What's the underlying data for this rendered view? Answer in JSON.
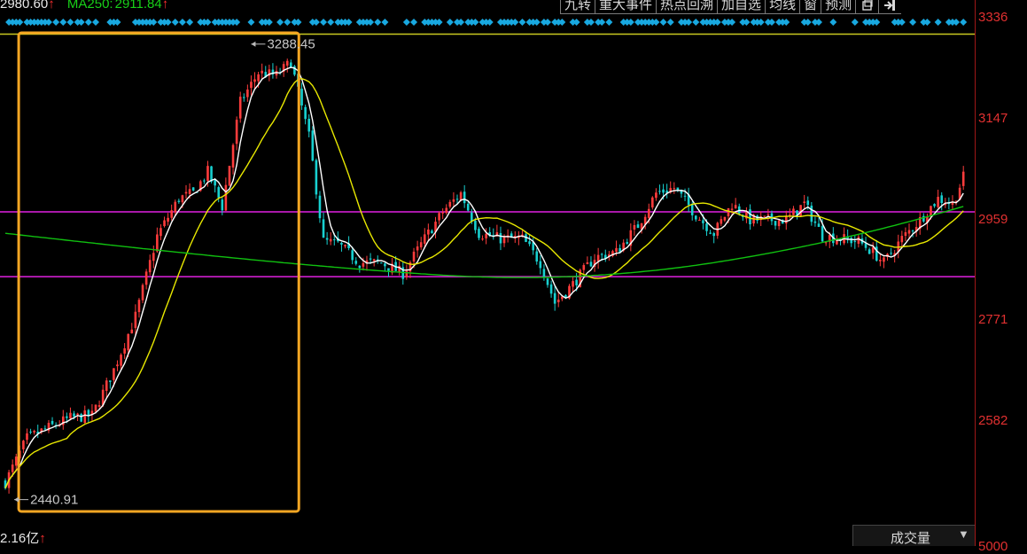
{
  "legend": {
    "ma_a_text": "2980.60",
    "ma_a_arrow": "↑",
    "ma_b_label": "MA250:",
    "ma_b_value": "2911.84",
    "ma_b_arrow": "↑",
    "ma_a_color": "#e8e8e8",
    "ma_b_color": "#18d018"
  },
  "toolbar": {
    "items": [
      "九转",
      "重大事件",
      "热点回溯",
      "加自选",
      "均线",
      "窗",
      "预测"
    ],
    "icons": [
      "restore-window-icon",
      "exit-icon"
    ]
  },
  "footer": {
    "volume_text": "2.16亿",
    "volume_arrow": "↑",
    "volume_selector": "成交量",
    "bottom_label_fragment": "5000"
  },
  "chart_data": {
    "type": "candlestick",
    "y_axis": {
      "ticks": [
        3336,
        3147,
        2959,
        2771,
        2582
      ],
      "range": [
        2440,
        3350
      ],
      "tick_color": "#e03030"
    },
    "annotations": [
      {
        "text": "3288.45",
        "kind": "period-high"
      },
      {
        "text": "2440.91",
        "kind": "period-low"
      }
    ],
    "horizontal_lines": [
      {
        "value": 3307,
        "color": "#c8c820"
      },
      {
        "value": 2975,
        "color": "#e020e0"
      },
      {
        "value": 2854,
        "color": "#e020e0"
      }
    ],
    "highlight_box": {
      "color": "#f5a623",
      "x_start_index": 1,
      "x_end_index": 78
    },
    "diamond_markers_color": "#18a8e0",
    "colors": {
      "up": "#ff3c3c",
      "down": "#18d0d0",
      "ma_short": "#ffffff",
      "ma_mid": "#e8e800",
      "ma_long": "#10c010"
    },
    "pivots": [
      [
        0,
        2470
      ],
      [
        6,
        2552
      ],
      [
        12,
        2572
      ],
      [
        18,
        2590
      ],
      [
        24,
        2595
      ],
      [
        30,
        2680
      ],
      [
        36,
        2780
      ],
      [
        42,
        2930
      ],
      [
        48,
        3000
      ],
      [
        52,
        3010
      ],
      [
        56,
        3050
      ],
      [
        60,
        2985
      ],
      [
        65,
        3180
      ],
      [
        70,
        3235
      ],
      [
        75,
        3230
      ],
      [
        79,
        3255
      ],
      [
        84,
        3115
      ],
      [
        88,
        2920
      ],
      [
        92,
        2915
      ],
      [
        98,
        2880
      ],
      [
        104,
        2880
      ],
      [
        110,
        2860
      ],
      [
        116,
        2925
      ],
      [
        121,
        2975
      ],
      [
        126,
        3010
      ],
      [
        131,
        2935
      ],
      [
        137,
        2925
      ],
      [
        143,
        2925
      ],
      [
        148,
        2880
      ],
      [
        152,
        2805
      ],
      [
        157,
        2840
      ],
      [
        163,
        2890
      ],
      [
        169,
        2900
      ],
      [
        175,
        2950
      ],
      [
        180,
        3010
      ],
      [
        185,
        3020
      ],
      [
        191,
        2970
      ],
      [
        196,
        2935
      ],
      [
        201,
        2990
      ],
      [
        206,
        2960
      ],
      [
        211,
        2960
      ],
      [
        216,
        2960
      ],
      [
        221,
        2990
      ],
      [
        226,
        2930
      ],
      [
        231,
        2925
      ],
      [
        236,
        2920
      ],
      [
        240,
        2900
      ],
      [
        243,
        2880
      ],
      [
        248,
        2925
      ],
      [
        253,
        2960
      ],
      [
        258,
        3000
      ],
      [
        262,
        2990
      ],
      [
        265,
        3040
      ]
    ]
  }
}
